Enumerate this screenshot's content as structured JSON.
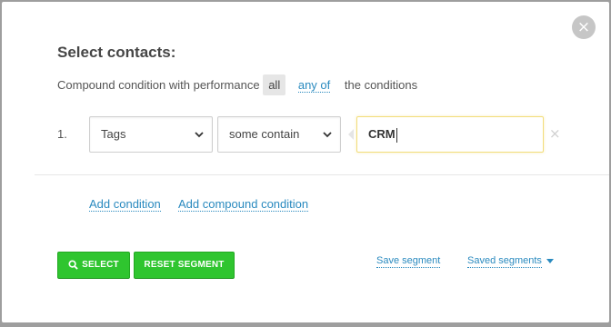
{
  "dialog": {
    "title": "Select contacts:",
    "close_icon": "×"
  },
  "condition": {
    "prefix": "Compound condition with performance",
    "option_all": "all",
    "option_any_of": "any of",
    "suffix": "the conditions"
  },
  "rows": [
    {
      "index": "1.",
      "field": "Tags",
      "operator": "some contain",
      "value": "CRM",
      "remove_icon": "×"
    }
  ],
  "links": {
    "add_condition": "Add condition",
    "add_compound_condition": "Add compound condition",
    "save_segment": "Save segment",
    "saved_segments": "Saved segments"
  },
  "buttons": {
    "select": "SELECT",
    "reset_segment": "RESET SEGMENT"
  },
  "colors": {
    "accent_link": "#2a8abf",
    "button_green": "#2fc52f",
    "input_focus_border": "#f2dd7a"
  }
}
